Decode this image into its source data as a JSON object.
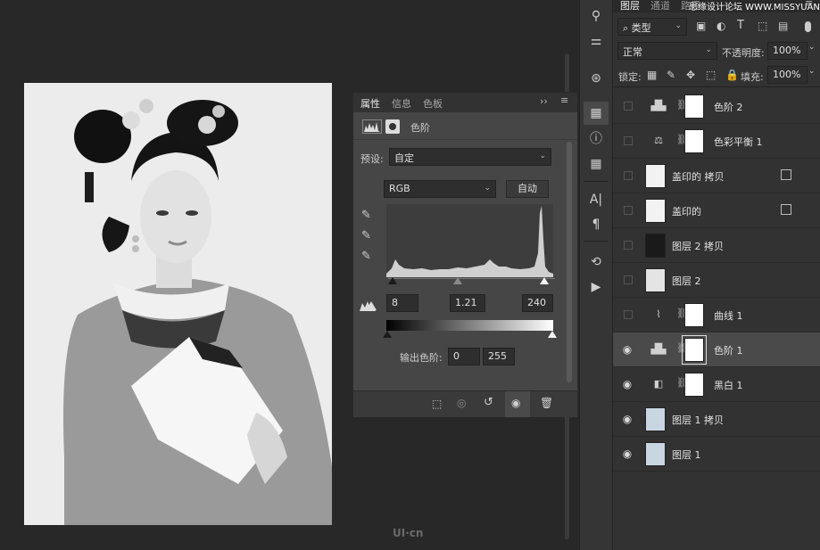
{
  "properties_panel": {
    "tabs": [
      "属性",
      "信息",
      "色板"
    ],
    "adjustment_title": "色阶",
    "preset_label": "预设:",
    "preset_value": "自定",
    "channel_value": "RGB",
    "auto_label": "自动",
    "input_shadow": "8",
    "input_midtone": "1.21",
    "input_highlight": "240",
    "output_label": "输出色阶:",
    "output_black": "0",
    "output_white": "255"
  },
  "layers_panel": {
    "tabs": [
      "图层",
      "通道",
      "路径"
    ],
    "filter_label": "类型",
    "blend_mode": "正常",
    "opacity_label": "不透明度:",
    "opacity_value": "100%",
    "lock_label": "锁定:",
    "fill_label": "填充:",
    "fill_value": "100%",
    "layers": [
      {
        "name": "色阶 2",
        "visible": false,
        "type": "levels"
      },
      {
        "name": "色彩平衡 1",
        "visible": false,
        "type": "color-balance"
      },
      {
        "name": "盖印的 拷贝",
        "visible": false,
        "type": "smart"
      },
      {
        "name": "盖印的",
        "visible": false,
        "type": "smart"
      },
      {
        "name": "图层 2 拷贝",
        "visible": false,
        "type": "pixel-dark"
      },
      {
        "name": "图层 2",
        "visible": false,
        "type": "pixel"
      },
      {
        "name": "曲线 1",
        "visible": false,
        "type": "curves"
      },
      {
        "name": "色阶 1",
        "visible": true,
        "type": "levels",
        "selected": true
      },
      {
        "name": "黑白 1",
        "visible": true,
        "type": "black-white"
      },
      {
        "name": "图层 1 拷贝",
        "visible": true,
        "type": "pixel"
      },
      {
        "name": "图层 1",
        "visible": true,
        "type": "pixel"
      }
    ]
  },
  "watermark": "UI·cn",
  "site_watermark": "思缘设计论坛 WWW.MISSYUAN.COM",
  "accent_color": "#e8281e"
}
